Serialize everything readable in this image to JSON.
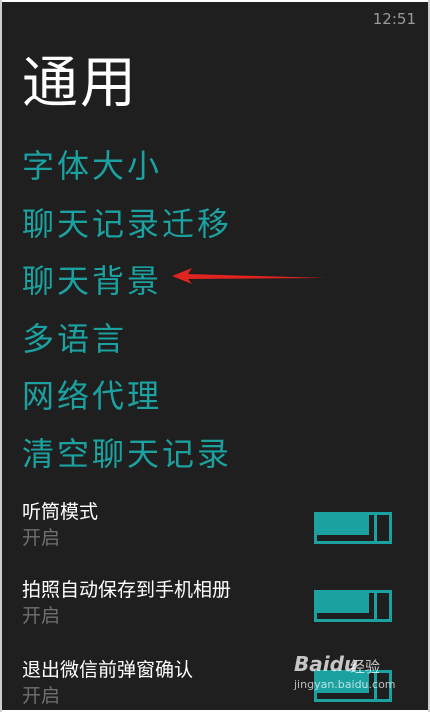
{
  "status_bar": {
    "time": "12:51"
  },
  "page": {
    "title": "通用"
  },
  "menu": {
    "items": [
      {
        "label": "字体大小"
      },
      {
        "label": "聊天记录迁移"
      },
      {
        "label": "聊天背景"
      },
      {
        "label": "多语言"
      },
      {
        "label": "网络代理"
      },
      {
        "label": "清空聊天记录"
      }
    ]
  },
  "settings": [
    {
      "label": "听筒模式",
      "value": "开启",
      "toggle": "on"
    },
    {
      "label": "拍照自动保存到手机相册",
      "value": "开启",
      "toggle": "on"
    },
    {
      "label": "退出微信前弹窗确认",
      "value": "开启",
      "toggle": "on"
    }
  ],
  "annotation": {
    "color": "#e0241f",
    "points_to": "聊天背景"
  },
  "watermark": {
    "brand": "Baidu",
    "text": "经验",
    "url": "jingyan.baidu.com"
  },
  "colors": {
    "accent": "#1ba1a0",
    "background": "#1f1f1f"
  }
}
